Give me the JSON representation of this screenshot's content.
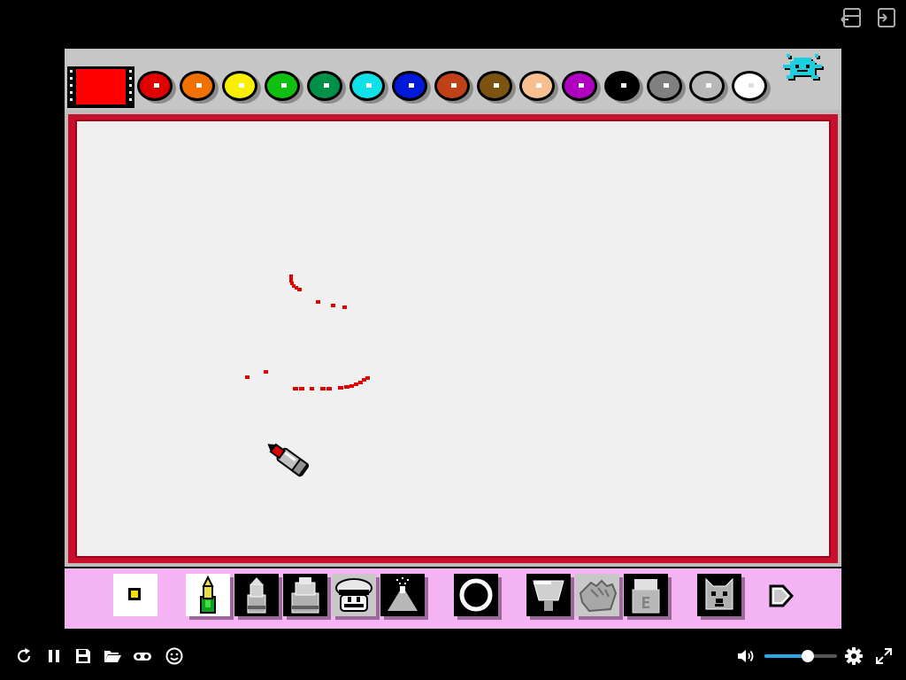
{
  "current_color": "#ff0000",
  "palette": [
    {
      "name": "red",
      "hex": "#e00000"
    },
    {
      "name": "orange",
      "hex": "#f07000"
    },
    {
      "name": "yellow",
      "hex": "#f8f000"
    },
    {
      "name": "green",
      "hex": "#10c010"
    },
    {
      "name": "dark-green",
      "hex": "#009048"
    },
    {
      "name": "cyan",
      "hex": "#10e0e8"
    },
    {
      "name": "blue",
      "hex": "#0018d8"
    },
    {
      "name": "rust",
      "hex": "#c04018"
    },
    {
      "name": "brown",
      "hex": "#7a5410"
    },
    {
      "name": "peach",
      "hex": "#f8c090"
    },
    {
      "name": "magenta",
      "hex": "#b000c0"
    },
    {
      "name": "black",
      "hex": "#000000"
    },
    {
      "name": "gray",
      "hex": "#808080"
    },
    {
      "name": "light-gray",
      "hex": "#b8b8b8"
    },
    {
      "name": "white",
      "hex": "#ffffff"
    }
  ],
  "colors": {
    "stroke": "#e00000",
    "canvas_border": "#c8102e",
    "toolbar_bg": "#f4b4f4",
    "volume_accent": "#2aa7e8"
  },
  "tools": [
    {
      "name": "brush-size-small"
    },
    {
      "name": "pencil"
    },
    {
      "name": "marker-small"
    },
    {
      "name": "marker-large"
    },
    {
      "name": "mario-stamp"
    },
    {
      "name": "spray-can"
    },
    {
      "name": "shape-circle"
    },
    {
      "name": "fill-bucket"
    },
    {
      "name": "hand"
    },
    {
      "name": "eraser",
      "label": "E"
    },
    {
      "name": "undo-dog"
    },
    {
      "name": "next-page"
    }
  ],
  "player_controls": [
    "restart",
    "pause",
    "save",
    "open",
    "gamepad",
    "emoji",
    "volume",
    "settings",
    "fullscreen"
  ],
  "volume_level": 0.6
}
